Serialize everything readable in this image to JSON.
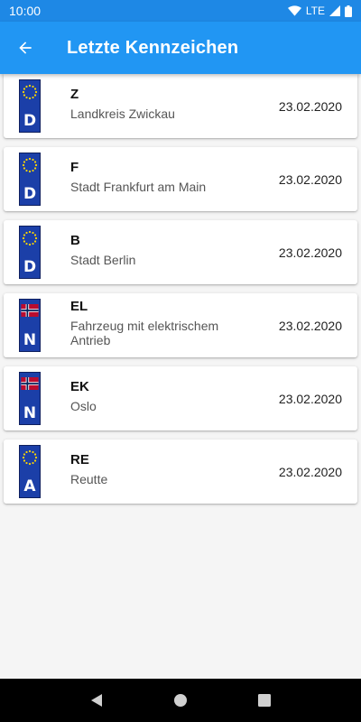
{
  "status_bar": {
    "time": "10:00",
    "network": "LTE"
  },
  "app_bar": {
    "title": "Letzte Kennzeichen",
    "back_icon": "arrow-back-icon"
  },
  "entries": [
    {
      "abbr": "Z",
      "region": "Landkreis Zwickau",
      "date": "23.02.2020",
      "country_code": "D",
      "emblem": "eu-stars"
    },
    {
      "abbr": "F",
      "region": "Stadt Frankfurt am Main",
      "date": "23.02.2020",
      "country_code": "D",
      "emblem": "eu-stars"
    },
    {
      "abbr": "B",
      "region": "Stadt Berlin",
      "date": "23.02.2020",
      "country_code": "D",
      "emblem": "eu-stars"
    },
    {
      "abbr": "EL",
      "region": "Fahrzeug mit elektrischem Antrieb",
      "date": "23.02.2020",
      "country_code": "N",
      "emblem": "norway-flag"
    },
    {
      "abbr": "EK",
      "region": "Oslo",
      "date": "23.02.2020",
      "country_code": "N",
      "emblem": "norway-flag"
    },
    {
      "abbr": "RE",
      "region": "Reutte",
      "date": "23.02.2020",
      "country_code": "A",
      "emblem": "eu-stars"
    }
  ],
  "colors": {
    "status_bar": "#1e88e5",
    "app_bar": "#2196f3",
    "plate_blue": "#1b3fa8",
    "eu_star": "#ffd700",
    "norway_red": "#ba0c2f",
    "norway_blue": "#00205b"
  }
}
